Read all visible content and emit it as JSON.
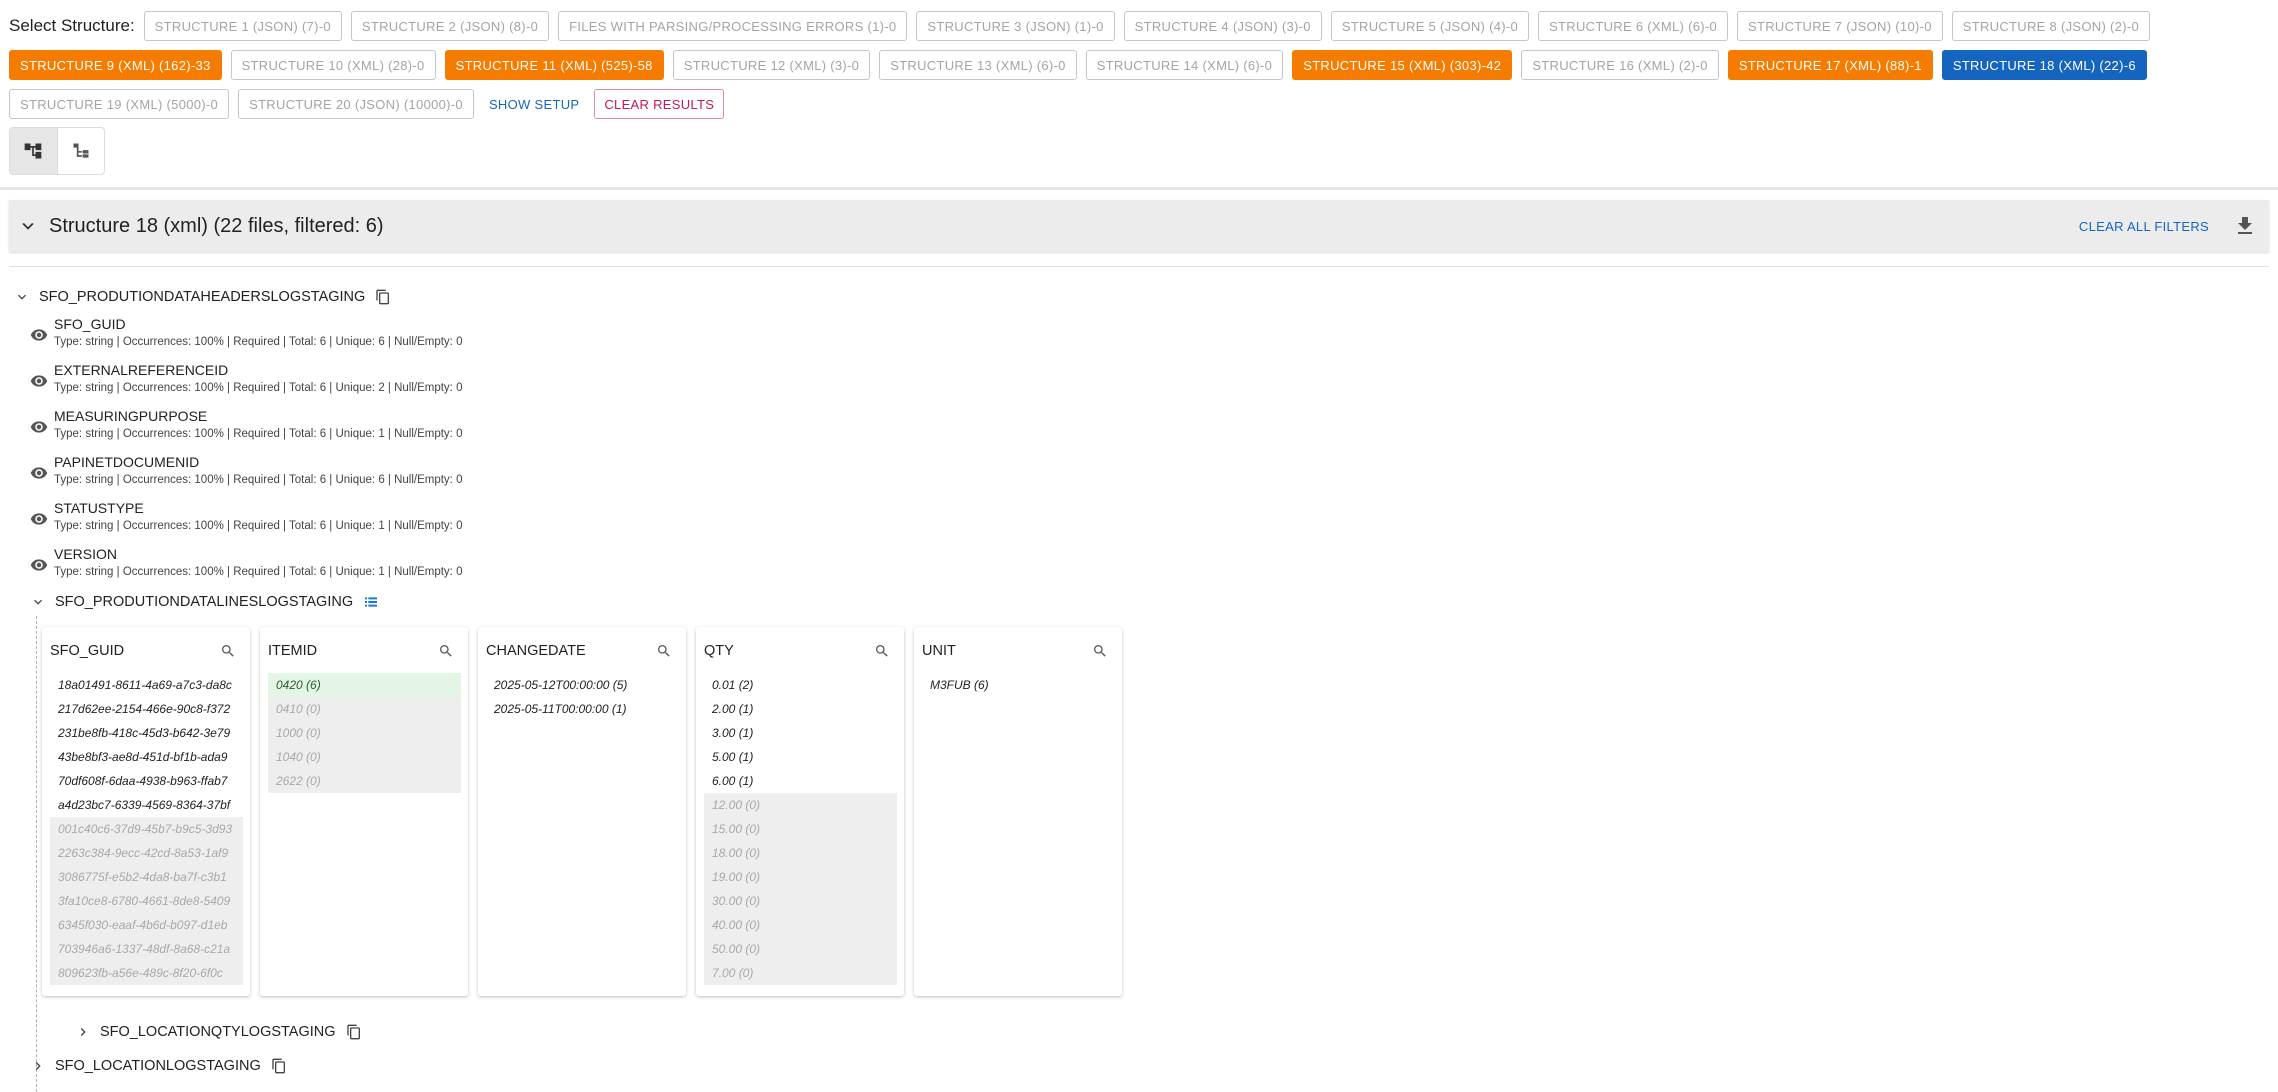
{
  "toolbar": {
    "select_label": "Select Structure:",
    "row1": [
      {
        "label": "STRUCTURE 1 (JSON) (7)-0",
        "variant": "default"
      },
      {
        "label": "STRUCTURE 2 (JSON) (8)-0",
        "variant": "default"
      },
      {
        "label": "FILES WITH PARSING/PROCESSING ERRORS (1)-0",
        "variant": "default"
      },
      {
        "label": "STRUCTURE 3 (JSON) (1)-0",
        "variant": "default"
      },
      {
        "label": "STRUCTURE 4 (JSON) (3)-0",
        "variant": "default"
      },
      {
        "label": "STRUCTURE 5 (JSON) (4)-0",
        "variant": "default"
      },
      {
        "label": "STRUCTURE 6 (XML) (6)-0",
        "variant": "default"
      },
      {
        "label": "STRUCTURE 7 (JSON) (10)-0",
        "variant": "default"
      },
      {
        "label": "STRUCTURE 8 (JSON) (2)-0",
        "variant": "default"
      }
    ],
    "row2": [
      {
        "label": "STRUCTURE 9 (XML) (162)-33",
        "variant": "orange"
      },
      {
        "label": "STRUCTURE 10 (XML) (28)-0",
        "variant": "default"
      },
      {
        "label": "STRUCTURE 11 (XML) (525)-58",
        "variant": "orange"
      },
      {
        "label": "STRUCTURE 12 (XML) (3)-0",
        "variant": "default"
      },
      {
        "label": "STRUCTURE 13 (XML) (6)-0",
        "variant": "default"
      },
      {
        "label": "STRUCTURE 14 (XML) (6)-0",
        "variant": "default"
      },
      {
        "label": "STRUCTURE 15 (XML) (303)-42",
        "variant": "orange"
      },
      {
        "label": "STRUCTURE 16 (XML) (2)-0",
        "variant": "default"
      },
      {
        "label": "STRUCTURE 17 (XML) (88)-1",
        "variant": "orange"
      },
      {
        "label": "STRUCTURE 18 (XML) (22)-6",
        "variant": "blue"
      }
    ],
    "row3": [
      {
        "label": "STRUCTURE 19 (XML) (5000)-0",
        "variant": "default"
      },
      {
        "label": "STRUCTURE 20 (JSON) (10000)-0",
        "variant": "default"
      }
    ],
    "show_setup": "SHOW SETUP",
    "clear_results": "CLEAR RESULTS",
    "colors": {
      "orange": "#f57c00",
      "blue": "#1565c0",
      "pink": "#c2185b"
    }
  },
  "view_toggle": [
    {
      "icon": "tree-view-icon",
      "active": true
    },
    {
      "icon": "list-tree-icon",
      "active": false
    }
  ],
  "accordion": {
    "title": "Structure 18 (xml) (22 files, filtered: 6)",
    "clear_all": "CLEAR ALL FILTERS"
  },
  "tree": {
    "root_label": "SFO_PRODUTIONDATAHEADERSLOGSTAGING",
    "fields": [
      {
        "name": "SFO_GUID",
        "meta": "Type: string | Occurrences: 100% | Required | Total: 6 | Unique: 6 | Null/Empty: 0"
      },
      {
        "name": "EXTERNALREFERENCEID",
        "meta": "Type: string | Occurrences: 100% | Required | Total: 6 | Unique: 2 | Null/Empty: 0"
      },
      {
        "name": "MEASURINGPURPOSE",
        "meta": "Type: string | Occurrences: 100% | Required | Total: 6 | Unique: 1 | Null/Empty: 0"
      },
      {
        "name": "PAPINETDOCUMENID",
        "meta": "Type: string | Occurrences: 100% | Required | Total: 6 | Unique: 6 | Null/Empty: 0"
      },
      {
        "name": "STATUSTYPE",
        "meta": "Type: string | Occurrences: 100% | Required | Total: 6 | Unique: 1 | Null/Empty: 0"
      },
      {
        "name": "VERSION",
        "meta": "Type: string | Occurrences: 100% | Required | Total: 6 | Unique: 1 | Null/Empty: 0"
      }
    ],
    "lines_label": "SFO_PRODUTIONDATALINESLOGSTAGING",
    "location_qty_label": "SFO_LOCATIONQTYLOGSTAGING",
    "location_label": "SFO_LOCATIONLOGSTAGING"
  },
  "columns": [
    {
      "header": "SFO_GUID",
      "values": [
        {
          "text": "18a01491-8611-4a69-a7c3-da8c",
          "state": "on"
        },
        {
          "text": "217d62ee-2154-466e-90c8-f372",
          "state": "on"
        },
        {
          "text": "231be8fb-418c-45d3-b642-3e79",
          "state": "on"
        },
        {
          "text": "43be8bf3-ae8d-451d-bf1b-ada9",
          "state": "on"
        },
        {
          "text": "70df608f-6daa-4938-b963-ffab7",
          "state": "on"
        },
        {
          "text": "a4d23bc7-6339-4569-8364-37bf",
          "state": "on"
        },
        {
          "text": "001c40c6-37d9-45b7-b9c5-3d93",
          "state": "off"
        },
        {
          "text": "2263c384-9ecc-42cd-8a53-1af9",
          "state": "off"
        },
        {
          "text": "3086775f-e5b2-4da8-ba7f-c3b1",
          "state": "off"
        },
        {
          "text": "3fa10ce8-6780-4661-8de8-5409",
          "state": "off"
        },
        {
          "text": "6345f030-eaaf-4b6d-b097-d1eb",
          "state": "off"
        },
        {
          "text": "703946a6-1337-48df-8a68-c21a",
          "state": "off"
        },
        {
          "text": "809623fb-a56e-489c-8f20-6f0c",
          "state": "off"
        }
      ]
    },
    {
      "header": "ITEMID",
      "values": [
        {
          "text": "0420 (6)",
          "state": "sel"
        },
        {
          "text": "0410 (0)",
          "state": "off"
        },
        {
          "text": "1000 (0)",
          "state": "off"
        },
        {
          "text": "1040 (0)",
          "state": "off"
        },
        {
          "text": "2622 (0)",
          "state": "off"
        }
      ]
    },
    {
      "header": "CHANGEDATE",
      "values": [
        {
          "text": "2025-05-12T00:00:00 (5)",
          "state": "on"
        },
        {
          "text": "2025-05-11T00:00:00 (1)",
          "state": "on"
        }
      ]
    },
    {
      "header": "QTY",
      "values": [
        {
          "text": "0.01 (2)",
          "state": "on"
        },
        {
          "text": "2.00 (1)",
          "state": "on"
        },
        {
          "text": "3.00 (1)",
          "state": "on"
        },
        {
          "text": "5.00 (1)",
          "state": "on"
        },
        {
          "text": "6.00 (1)",
          "state": "on"
        },
        {
          "text": "12.00 (0)",
          "state": "off"
        },
        {
          "text": "15.00 (0)",
          "state": "off"
        },
        {
          "text": "18.00 (0)",
          "state": "off"
        },
        {
          "text": "19.00 (0)",
          "state": "off"
        },
        {
          "text": "30.00 (0)",
          "state": "off"
        },
        {
          "text": "40.00 (0)",
          "state": "off"
        },
        {
          "text": "50.00 (0)",
          "state": "off"
        },
        {
          "text": "7.00 (0)",
          "state": "off"
        }
      ]
    },
    {
      "header": "UNIT",
      "values": [
        {
          "text": "M3FUB (6)",
          "state": "on"
        }
      ]
    }
  ]
}
